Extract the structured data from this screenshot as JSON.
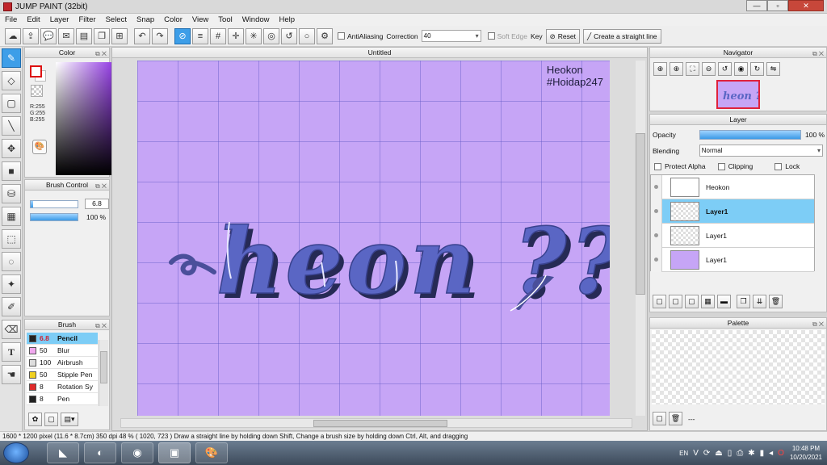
{
  "app": {
    "title": "JUMP PAINT (32bit)"
  },
  "menu": [
    "File",
    "Edit",
    "Layer",
    "Filter",
    "Select",
    "Snap",
    "Color",
    "View",
    "Tool",
    "Window",
    "Help"
  ],
  "toolbar": {
    "antialiasing_label": "AntiAliasing",
    "correction_label": "Correction",
    "correction_value": "40",
    "soft_edge_label": "Soft Edge",
    "key_label": "Key",
    "reset_label": "Reset",
    "straight_line_label": "Create a straight line"
  },
  "color_panel": {
    "title": "Color",
    "r": "R:255",
    "g": "G:255",
    "b": "B:255"
  },
  "brush_control": {
    "title": "Brush Control",
    "size": "6.8",
    "opacity": "100 %",
    "opacity_fraction": 1.0
  },
  "brush_panel": {
    "title": "Brush",
    "items": [
      {
        "size": "6.8",
        "name": "Pencil",
        "color": "#222222",
        "selected": true
      },
      {
        "size": "50",
        "name": "Blur",
        "color": "#f0a8ee"
      },
      {
        "size": "100",
        "name": "Airbrush",
        "color": "#dddddd"
      },
      {
        "size": "50",
        "name": "Stipple Pen",
        "color": "#f0d020"
      },
      {
        "size": "8",
        "name": "Rotation Sy",
        "color": "#e02a2a"
      },
      {
        "size": "8",
        "name": "Pen",
        "color": "#222222"
      }
    ]
  },
  "canvas": {
    "tab_title": "Untitled",
    "author_line1": "Heokon",
    "author_line2": "#Hoidap247",
    "artwork_text": "heon ??"
  },
  "navigator": {
    "title": "Navigator"
  },
  "layer_panel": {
    "title": "Layer",
    "opacity_label": "Opacity",
    "opacity_value": "100 %",
    "opacity_fraction": 1.0,
    "blending_label": "Blending",
    "blending_value": "Normal",
    "protect_alpha_label": "Protect Alpha",
    "clipping_label": "Clipping",
    "lock_label": "Lock",
    "layers": [
      {
        "name": "Heokon",
        "selected": false
      },
      {
        "name": "Layer1",
        "selected": true
      },
      {
        "name": "Layer1",
        "selected": false
      },
      {
        "name": "Layer1",
        "selected": false
      }
    ]
  },
  "palette": {
    "title": "Palette",
    "footer": "---"
  },
  "status": {
    "text": "1600 * 1200 pixel  (11.6 * 8.7cm)  350 dpi  48 %  ( 1020, 723 )  Draw a straight line by holding down Shift, Change a brush size by holding down Ctrl, Alt, and dragging"
  },
  "taskbar": {
    "lang": "EN",
    "time": "10:48 PM",
    "date": "10/20/2021"
  },
  "colors": {
    "accent": "#3d9ee8",
    "canvas": "#c6a5f6",
    "ink": "#5a66c4",
    "selection": "#7dcdf6"
  }
}
